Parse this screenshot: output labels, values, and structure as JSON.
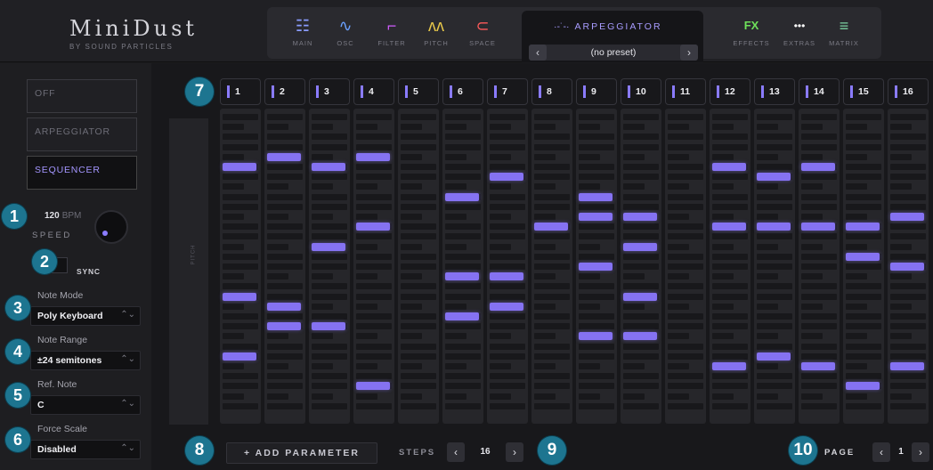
{
  "brand": {
    "title": "MiniDust",
    "subtitle": "BY SOUND PARTICLES"
  },
  "nav": {
    "tabs": [
      {
        "label": "MAIN",
        "icon": "grid-icon",
        "glyph": "☷",
        "color": "#8a9cff"
      },
      {
        "label": "OSC",
        "icon": "wave-icon",
        "glyph": "∿",
        "color": "#6aa0ff"
      },
      {
        "label": "FILTER",
        "icon": "filter-curve-icon",
        "glyph": "⌐",
        "color": "#d05cff"
      },
      {
        "label": "PITCH",
        "icon": "pitch-wave-icon",
        "glyph": "ʌʌ",
        "color": "#e8c84a"
      },
      {
        "label": "SPACE",
        "icon": "space-orbit-icon",
        "glyph": "⊂",
        "color": "#ff5a5a"
      },
      {
        "label": "EFFECTS",
        "icon": "fx-icon",
        "glyph": "FX",
        "color": "#6ee05a"
      },
      {
        "label": "EXTRAS",
        "icon": "dots-icon",
        "glyph": "•••",
        "color": "#ffffff"
      },
      {
        "label": "MATRIX",
        "icon": "matrix-icon",
        "glyph": "≡",
        "color": "#7ad0a0"
      }
    ],
    "active_panel": {
      "title": "ARPEGGIATOR",
      "icon": "arpeggiator-icon",
      "preset": "(no preset)"
    }
  },
  "sidebar": {
    "modes": [
      {
        "label": "OFF",
        "active": false
      },
      {
        "label": "ARPEGGIATOR",
        "active": false
      },
      {
        "label": "SEQUENCER",
        "active": true
      }
    ],
    "bpm_value": "120",
    "bpm_unit": "BPM",
    "speed_label": "SPEED",
    "sync_label": "SYNC",
    "note_mode": {
      "label": "Note Mode",
      "value": "Poly Keyboard"
    },
    "note_range": {
      "label": "Note Range",
      "value": "±24 semitones"
    },
    "ref_note": {
      "label": "Ref. Note",
      "value": "C"
    },
    "force_scale": {
      "label": "Force Scale",
      "value": "Disabled"
    }
  },
  "grid": {
    "pitch_label": "PITCH",
    "steps": [
      "1",
      "2",
      "3",
      "4",
      "5",
      "6",
      "7",
      "8",
      "9",
      "10",
      "11",
      "12",
      "13",
      "14",
      "15",
      "16"
    ],
    "notes": [
      [
        18,
        5,
        24
      ],
      [
        19,
        4,
        21
      ],
      [
        5,
        13,
        21
      ],
      [
        4,
        11,
        27
      ],
      [],
      [
        8,
        16,
        20
      ],
      [
        19,
        16,
        6
      ],
      [
        11
      ],
      [
        10,
        8,
        15,
        22
      ],
      [
        18,
        10,
        13,
        22
      ],
      [],
      [
        5,
        11,
        25
      ],
      [
        6,
        11,
        24
      ],
      [
        5,
        11,
        25
      ],
      [
        11,
        14,
        27
      ],
      [
        10,
        15,
        25
      ]
    ]
  },
  "footer": {
    "add_parameter": "+ ADD PARAMETER",
    "steps_label": "STEPS",
    "steps_value": "16",
    "page_label": "PAGE",
    "page_value": "1"
  },
  "badges": [
    "1",
    "2",
    "3",
    "4",
    "5",
    "6",
    "7",
    "8",
    "9",
    "10"
  ],
  "colors": {
    "accent": "#8572f2",
    "badge": "#1d7590",
    "background": "#1b1b1e"
  }
}
